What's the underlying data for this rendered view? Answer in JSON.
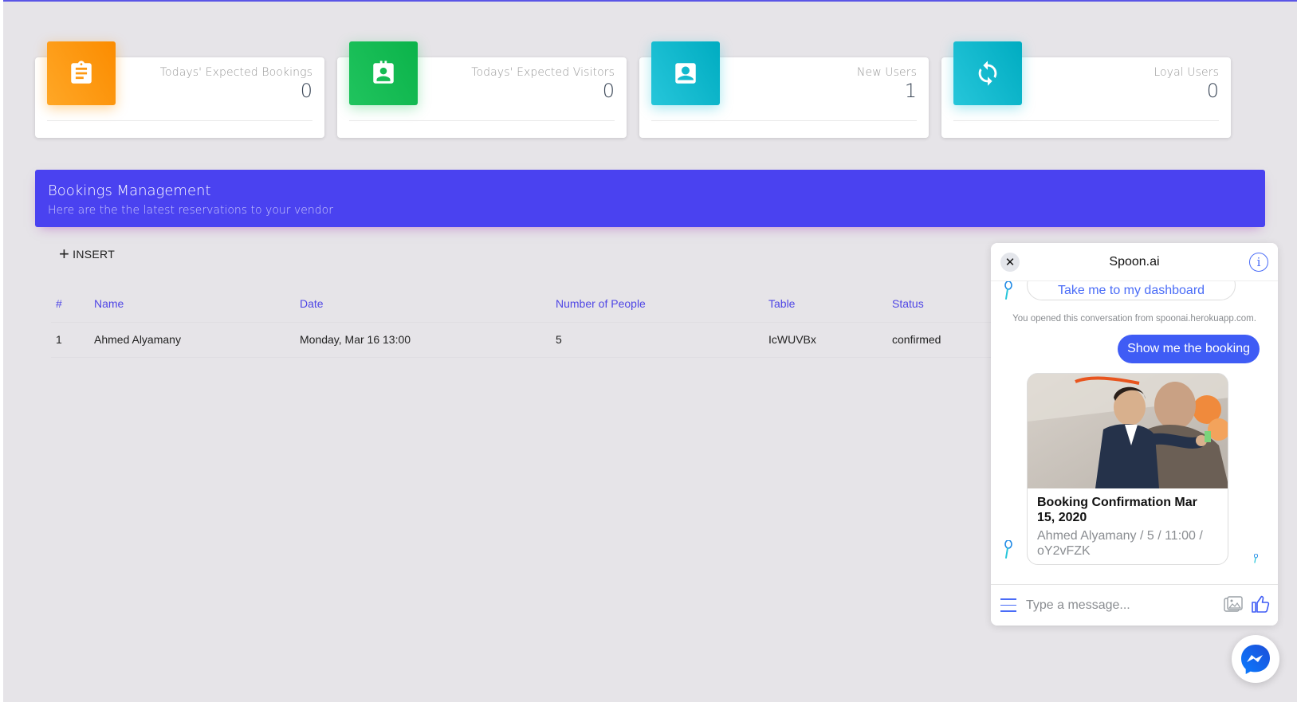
{
  "stats": [
    {
      "label": "Todays' Expected Bookings",
      "value": "0",
      "icon": "clipboard-icon",
      "color": "#fb8c00"
    },
    {
      "label": "Todays' Expected Visitors",
      "value": "0",
      "icon": "badge-icon",
      "color": "#0bb34a"
    },
    {
      "label": "New Users",
      "value": "1",
      "icon": "contact-card-icon",
      "color": "#00acc1"
    },
    {
      "label": "Loyal Users",
      "value": "0",
      "icon": "refresh-icon",
      "color": "#00acc1"
    }
  ],
  "bookings": {
    "title": "Bookings Management",
    "subtitle": "Here are the the latest reservations to your vendor",
    "insert_label": "INSERT",
    "columns": [
      "#",
      "Name",
      "Date",
      "Number of People",
      "Table",
      "Status"
    ],
    "rows": [
      [
        "1",
        "Ahmed Alyamany",
        "Monday, Mar 16 13:00",
        "5",
        "IcWUVBx",
        "confirmed"
      ]
    ]
  },
  "chat": {
    "title": "Spoon.ai",
    "quick_reply": "Take me to my dashboard",
    "opened_note": "You opened this conversation from spoonai.herokuapp.com.",
    "user_message": "Show me the booking",
    "card_title": "Booking Confirmation Mar 15, 2020",
    "card_subtitle": "Ahmed Alyamany / 5 / 11:00 / oY2vFZK",
    "input_placeholder": "Type a message...",
    "close_glyph": "✕",
    "info_glyph": "i"
  },
  "colors": {
    "accent": "#4a42f0",
    "messenger_blue": "#3f5cf5"
  }
}
